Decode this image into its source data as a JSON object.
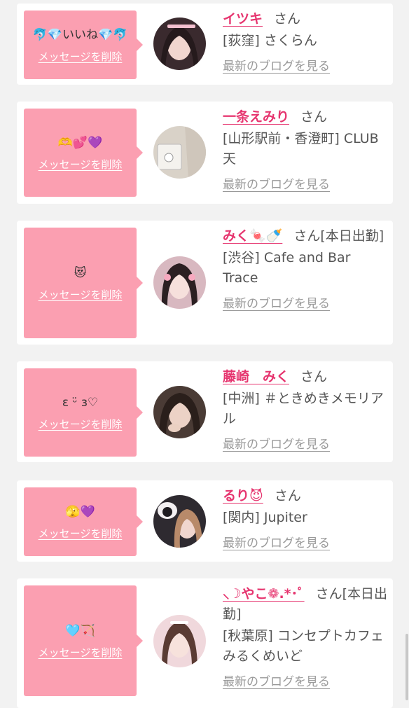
{
  "items": [
    {
      "message": "🐬💎いいね💎🐬",
      "delete_label": "メッセージを削除",
      "name": "イツキ",
      "honorific": "さん",
      "shop": "[荻窪] さくらん",
      "blog_label": "最新のブログを見る"
    },
    {
      "message": "🫶💕💜",
      "delete_label": "メッセージを削除",
      "name": "一条えみり",
      "honorific": "さん",
      "shop": "[山形駅前・香澄町] CLUB 天",
      "blog_label": "最新のブログを見る"
    },
    {
      "message": "😻",
      "delete_label": "メッセージを削除",
      "name": "みく🍬🍼",
      "honorific": "さん[本日出勤]",
      "shop": "[渋谷] Cafe and Bar Trace",
      "blog_label": "最新のブログを見る"
    },
    {
      "message": "ɛ ᵕ̈ ɜ♡",
      "delete_label": "メッセージを削除",
      "name": "藤崎　みく",
      "honorific": "さん",
      "shop": "[中洲] ＃ときめきメモリアル",
      "blog_label": "最新のブログを見る"
    },
    {
      "message": "🫣💜",
      "delete_label": "メッセージを削除",
      "name": "るり😈",
      "honorific": "さん",
      "shop": "[関内] Jupiter",
      "blog_label": "最新のブログを見る"
    },
    {
      "message": "🩵🏹",
      "delete_label": "メッセージを削除",
      "name": "⸜☽やこ❁.*･ﾟ",
      "honorific": "さん[本日出勤]",
      "shop": "[秋葉原] コンセプトカフェ みるくめいど",
      "blog_label": "最新のブログを見る"
    }
  ],
  "avatar_colors": [
    "#3a2a2e",
    "#d9d2c8",
    "#d8b8c0",
    "#4a3b35",
    "#2e2a30",
    "#f0d8dc"
  ]
}
